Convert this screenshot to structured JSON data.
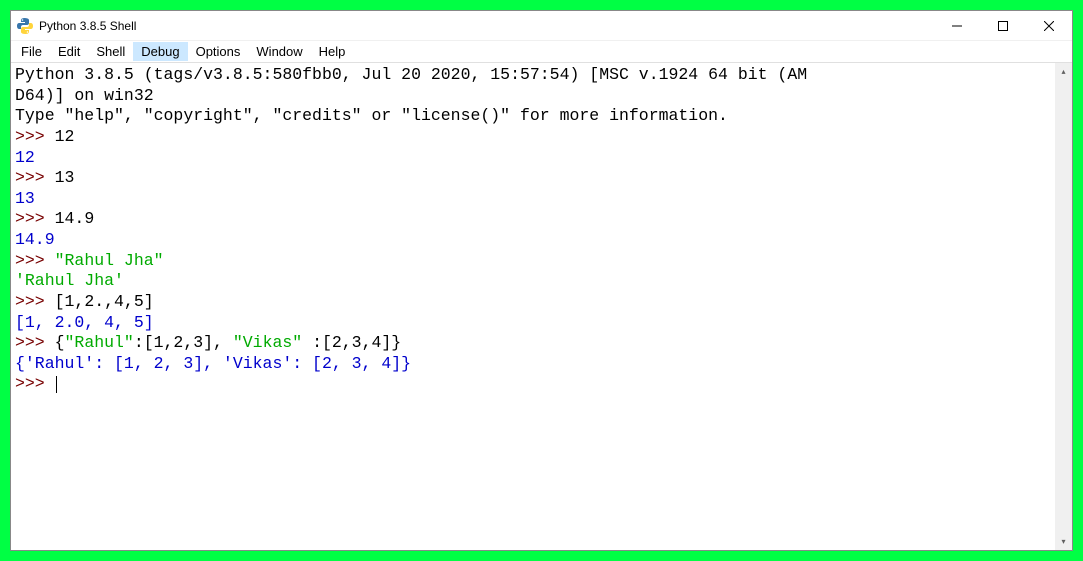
{
  "window": {
    "title": "Python 3.8.5 Shell"
  },
  "menubar": {
    "items": [
      "File",
      "Edit",
      "Shell",
      "Debug",
      "Options",
      "Window",
      "Help"
    ],
    "highlighted_index": 3
  },
  "shell": {
    "banner_line1": "Python 3.8.5 (tags/v3.8.5:580fbb0, Jul 20 2020, 15:57:54) [MSC v.1924 64 bit (AM",
    "banner_line2": "D64)] on win32",
    "banner_line3": "Type \"help\", \"copyright\", \"credits\" or \"license()\" for more information.",
    "prompt": ">>> ",
    "entries": [
      {
        "input": "12",
        "output": "12",
        "out_class": "output-num"
      },
      {
        "input": "13",
        "output": "13",
        "out_class": "output-num"
      },
      {
        "input": "14.9",
        "output": "14.9",
        "out_class": "output-num"
      },
      {
        "input_str": "\"Rahul Jha\"",
        "output": "'Rahul Jha'",
        "out_class": "output-str"
      },
      {
        "input": "[1,2.,4,5]",
        "output": "[1, 2.0, 4, 5]",
        "out_class": "output-num"
      },
      {
        "input_mixed": [
          {
            "t": "{",
            "c": ""
          },
          {
            "t": "\"Rahul\"",
            "c": "input-str"
          },
          {
            "t": ":[1,2,3], ",
            "c": ""
          },
          {
            "t": "\"Vikas\"",
            "c": "input-str"
          },
          {
            "t": " :[2,3,4]}",
            "c": ""
          }
        ],
        "output": "{'Rahul': [1, 2, 3], 'Vikas': [2, 3, 4]}",
        "out_class": "output-num"
      }
    ]
  },
  "scroll": {
    "up": "▴",
    "down": "▾"
  }
}
